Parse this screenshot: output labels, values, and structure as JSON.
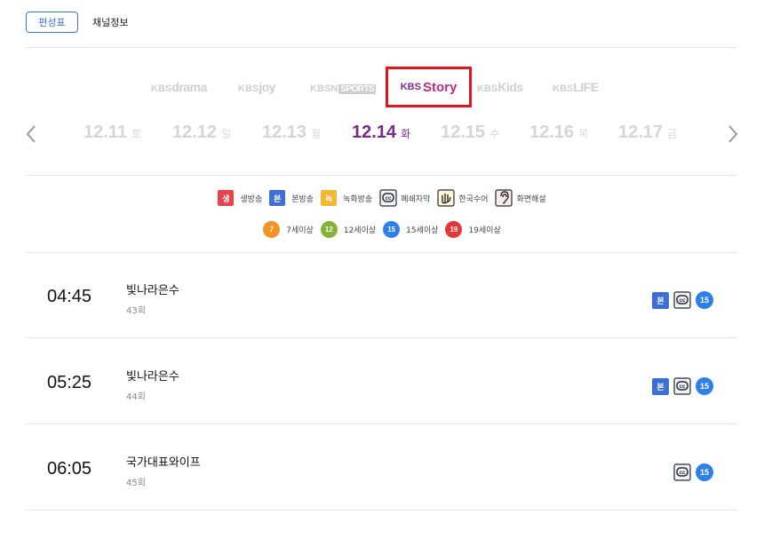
{
  "tabs": {
    "schedule": "편성표",
    "channel_info": "채널정보"
  },
  "channels": [
    {
      "kbs": "KBS",
      "name": "drama"
    },
    {
      "kbs": "KBS",
      "name": "joy"
    },
    {
      "kbs": "KBSN",
      "name": "SPORTS"
    },
    {
      "kbs": "KBS",
      "name": "Story",
      "selected": true
    },
    {
      "kbs": "KBS",
      "name": "Kids"
    },
    {
      "kbs": "KBS",
      "name": "LIFE"
    }
  ],
  "dates": [
    {
      "date": "12.11",
      "day": "토"
    },
    {
      "date": "12.12",
      "day": "일"
    },
    {
      "date": "12.13",
      "day": "월"
    },
    {
      "date": "12.14",
      "day": "화",
      "active": true
    },
    {
      "date": "12.15",
      "day": "수"
    },
    {
      "date": "12.16",
      "day": "목"
    },
    {
      "date": "12.17",
      "day": "금"
    }
  ],
  "legend": {
    "live": {
      "badge": "생",
      "label": "생방송",
      "color": "#e8424a"
    },
    "original": {
      "badge": "본",
      "label": "본방송",
      "color": "#3e6fd6"
    },
    "recorded": {
      "badge": "녹",
      "label": "녹화방송",
      "color": "#f4b731"
    },
    "cc": {
      "icon": "closed-caption-icon",
      "label": "폐쇄자막"
    },
    "sign": {
      "icon": "sign-language-icon",
      "label": "한국수어"
    },
    "audio_desc": {
      "icon": "ear-icon",
      "label": "화면해설"
    },
    "age7": {
      "badge": "7",
      "label": "7세이상",
      "color": "#f39323"
    },
    "age12": {
      "badge": "12",
      "label": "12세이상",
      "color": "#82b537"
    },
    "age15": {
      "badge": "15",
      "label": "15세이상",
      "color": "#2f80e6"
    },
    "age19": {
      "badge": "19",
      "label": "19세이상",
      "color": "#e5363c"
    }
  },
  "programs": [
    {
      "time": "04:45",
      "title": "빛나라은수",
      "episode": "43회",
      "badge_original": "본",
      "rating": "15"
    },
    {
      "time": "05:25",
      "title": "빛나라은수",
      "episode": "44회",
      "badge_original": "본",
      "rating": "15"
    },
    {
      "time": "06:05",
      "title": "국가대표와이프",
      "episode": "45회",
      "rating": "15"
    }
  ]
}
